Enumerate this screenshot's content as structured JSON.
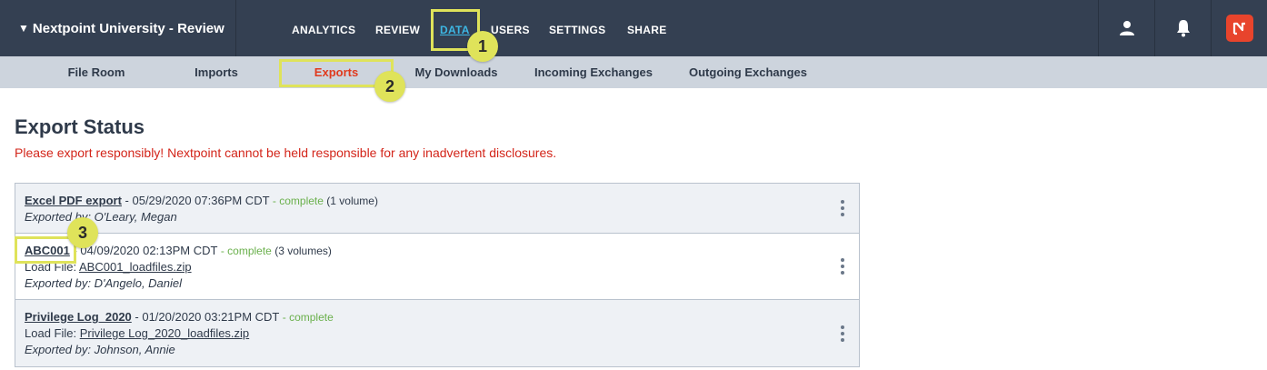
{
  "header": {
    "project_title": "Nextpoint University - Review",
    "nav": [
      {
        "label": "ANALYTICS"
      },
      {
        "label": "REVIEW"
      },
      {
        "label": "DATA",
        "active": true
      },
      {
        "label": "USERS"
      },
      {
        "label": "SETTINGS"
      },
      {
        "label": "SHARE"
      }
    ],
    "icons": [
      "user-icon",
      "bell-icon",
      "nextpoint-logo"
    ]
  },
  "subnav": {
    "items": [
      {
        "label": "File Room"
      },
      {
        "label": "Imports"
      },
      {
        "label": "Exports",
        "active": true
      },
      {
        "label": "My Downloads"
      },
      {
        "label": "Incoming Exchanges"
      },
      {
        "label": "Outgoing Exchanges"
      }
    ]
  },
  "markers": [
    "1",
    "2",
    "3"
  ],
  "page": {
    "title": "Export Status",
    "warning": "Please export responsibly! Nextpoint cannot be held responsible for any inadvertent disclosures."
  },
  "exports": [
    {
      "name": "Excel PDF export",
      "date": " - 05/29/2020 07:36PM CDT ",
      "status": "- complete",
      "volumes": " (1 volume)",
      "exported_by": "Exported by: O'Leary, Megan"
    },
    {
      "name": "ABC001",
      "date": " - 04/09/2020 02:13PM CDT ",
      "status": "- complete",
      "volumes": " (3 volumes)",
      "load_file_label": "Load File: ",
      "load_file": "ABC001_loadfiles.zip",
      "exported_by": "Exported by: D'Angelo, Daniel"
    },
    {
      "name": "Privilege Log_2020",
      "date": " - 01/20/2020 03:21PM CDT ",
      "status": "- complete",
      "load_file_label": "Load File: ",
      "load_file": "Privilege Log_2020_loadfiles.zip",
      "exported_by": "Exported by: Johnson, Annie"
    }
  ],
  "colors": {
    "topbar": "#344052",
    "subnav": "#cdd4dd",
    "accent_active_sub": "#e03a1e",
    "accent_active_nav": "#3db7e4",
    "status_complete": "#6ab04c",
    "warning": "#d3251a",
    "highlight": "#dfe35a"
  }
}
